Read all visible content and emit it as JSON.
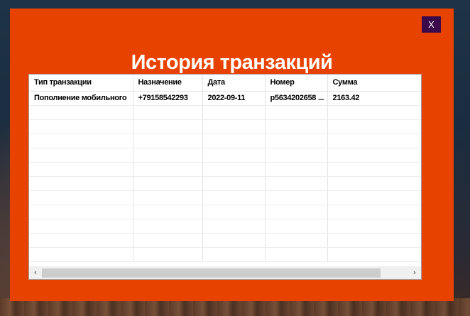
{
  "dialog": {
    "title": "История транзакций",
    "close_label": "X"
  },
  "table": {
    "columns": [
      "Тип транзакции",
      "Назначение",
      "Дата",
      "Номер",
      "Сумма"
    ],
    "rows": [
      [
        "Пополнение мобильного",
        "+79158542293",
        "2022-09-11",
        "p5634202658 ...",
        "2163.42"
      ]
    ],
    "empty_rows": 11
  },
  "scrollbar": {
    "left_arrow": "‹",
    "right_arrow": "›",
    "thumb_fraction": 0.9
  },
  "colors": {
    "dialog_bg": "#e84200",
    "close_bg": "#3a0a4a",
    "title_text": "#ffffff"
  }
}
